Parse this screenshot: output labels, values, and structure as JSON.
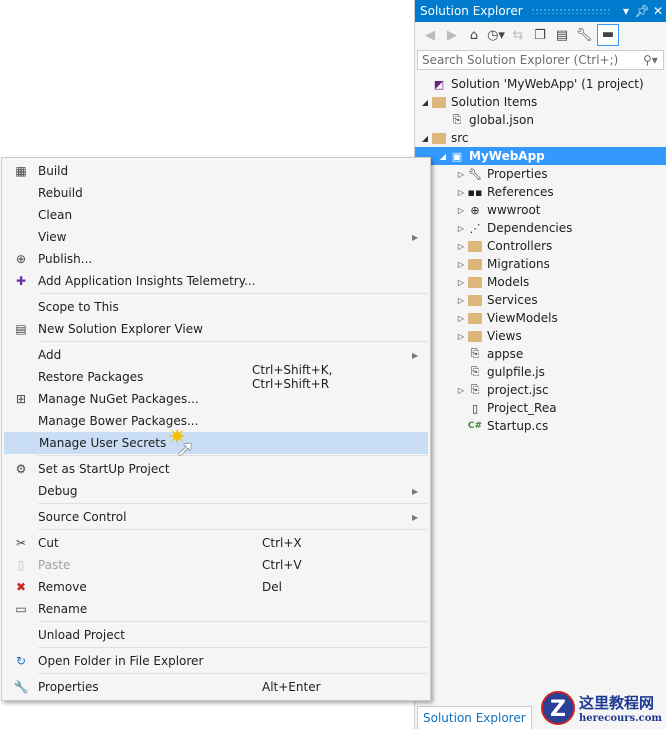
{
  "panel": {
    "title": "Solution Explorer",
    "search_placeholder": "Search Solution Explorer (Ctrl+;)",
    "tab_label": "Solution Explorer"
  },
  "tree": [
    {
      "label": "Solution 'MyWebApp' (1 project)",
      "depth": 0,
      "arrow": "",
      "icon": "solution-icon"
    },
    {
      "label": "Solution Items",
      "depth": 0,
      "arrow": "◢",
      "icon": "folder-icon"
    },
    {
      "label": "global.json",
      "depth": 1,
      "arrow": "",
      "icon": "json-file-icon"
    },
    {
      "label": "src",
      "depth": 0,
      "arrow": "◢",
      "icon": "folder-icon"
    },
    {
      "label": "MyWebApp",
      "depth": 1,
      "arrow": "◢",
      "icon": "web-project-icon",
      "selected": true
    },
    {
      "label": "Properties",
      "depth": 2,
      "arrow": "▷",
      "icon": "wrench-icon"
    },
    {
      "label": "References",
      "depth": 2,
      "arrow": "▷",
      "icon": "references-icon"
    },
    {
      "label": "wwwroot",
      "depth": 2,
      "arrow": "▷",
      "icon": "globe-icon"
    },
    {
      "label": "Dependencies",
      "depth": 2,
      "arrow": "▷",
      "icon": "dependencies-icon"
    },
    {
      "label": "Controllers",
      "depth": 2,
      "arrow": "▷",
      "icon": "folder-icon"
    },
    {
      "label": "Migrations",
      "depth": 2,
      "arrow": "▷",
      "icon": "folder-icon"
    },
    {
      "label": "Models",
      "depth": 2,
      "arrow": "▷",
      "icon": "folder-icon"
    },
    {
      "label": "Services",
      "depth": 2,
      "arrow": "▷",
      "icon": "folder-icon"
    },
    {
      "label": "ViewModels",
      "depth": 2,
      "arrow": "▷",
      "icon": "folder-icon"
    },
    {
      "label": "Views",
      "depth": 2,
      "arrow": "▷",
      "icon": "folder-icon"
    },
    {
      "label": "appse",
      "depth": 2,
      "arrow": "",
      "icon": "json-file-icon"
    },
    {
      "label": "gulpfile.js",
      "depth": 2,
      "arrow": "",
      "icon": "js-file-icon"
    },
    {
      "label": "project.jsc",
      "depth": 2,
      "arrow": "▷",
      "icon": "json-file-icon"
    },
    {
      "label": "Project_Rea",
      "depth": 2,
      "arrow": "",
      "icon": "file-icon"
    },
    {
      "label": "Startup.cs",
      "depth": 2,
      "arrow": "",
      "icon": "csharp-file-icon"
    }
  ],
  "menu": [
    {
      "label": "Build",
      "icon": "build-icon",
      "glyph": "▦"
    },
    {
      "label": "Rebuild"
    },
    {
      "label": "Clean"
    },
    {
      "label": "View",
      "submenu": true
    },
    {
      "label": "Publish...",
      "icon": "publish-icon",
      "glyph": "⊕"
    },
    {
      "label": "Add Application Insights Telemetry...",
      "icon": "insights-icon",
      "glyph": "✚"
    },
    {
      "sep": true
    },
    {
      "label": "Scope to This"
    },
    {
      "label": "New Solution Explorer View",
      "icon": "new-view-icon",
      "glyph": "▤"
    },
    {
      "sep": true
    },
    {
      "label": "Add",
      "submenu": true
    },
    {
      "label": "Restore Packages",
      "shortcut": "Ctrl+Shift+K, Ctrl+Shift+R"
    },
    {
      "label": "Manage NuGet Packages...",
      "icon": "nuget-icon",
      "glyph": "⊞"
    },
    {
      "label": "Manage Bower Packages..."
    },
    {
      "label": "Manage User Secrets",
      "highlighted": true
    },
    {
      "sep": true
    },
    {
      "label": "Set as StartUp Project",
      "icon": "gear-icon",
      "glyph": "⚙"
    },
    {
      "label": "Debug",
      "submenu": true
    },
    {
      "sep": true
    },
    {
      "label": "Source Control",
      "submenu": true
    },
    {
      "sep": true
    },
    {
      "label": "Cut",
      "shortcut": "Ctrl+X",
      "icon": "scissors-icon",
      "glyph": "✂"
    },
    {
      "label": "Paste",
      "shortcut": "Ctrl+V",
      "icon": "paste-icon",
      "glyph": "▯",
      "disabled": true
    },
    {
      "label": "Remove",
      "shortcut": "Del",
      "icon": "remove-icon",
      "glyph": "✖",
      "color": "#c42b1c"
    },
    {
      "label": "Rename",
      "icon": "rename-icon",
      "glyph": "▭"
    },
    {
      "sep": true
    },
    {
      "label": "Unload Project"
    },
    {
      "sep": true
    },
    {
      "label": "Open Folder in File Explorer",
      "icon": "refresh-icon",
      "glyph": "↻",
      "color": "#1e6fc2"
    },
    {
      "sep": true
    },
    {
      "label": "Properties",
      "shortcut": "Alt+Enter",
      "icon": "wrench-icon",
      "glyph": "🔧"
    }
  ],
  "watermark": {
    "cn": "这里教程网",
    "site": "herecours.com"
  }
}
